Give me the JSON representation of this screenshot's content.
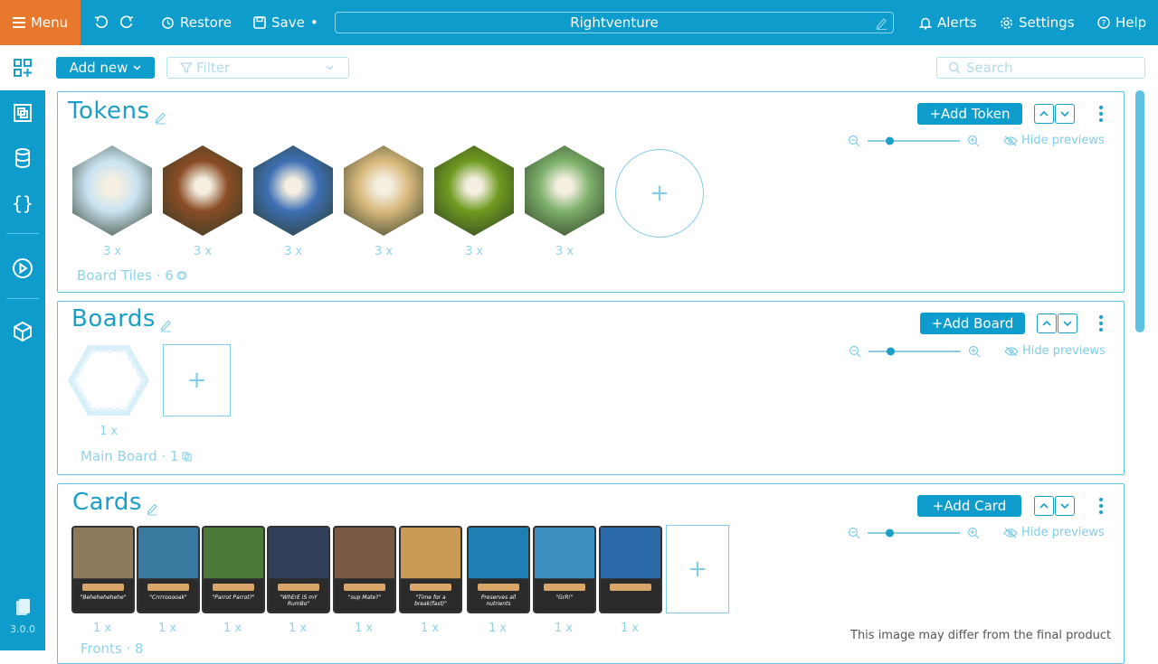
{
  "topbar": {
    "menu_label": "Menu",
    "restore_label": "Restore",
    "save_label": "Save",
    "save_dot": "•",
    "project_title": "Rightventure",
    "alerts_label": "Alerts",
    "settings_label": "Settings",
    "help_label": "Help"
  },
  "toolbar": {
    "add_new_label": "Add new",
    "filter_placeholder": "Filter",
    "search_placeholder": "Search"
  },
  "sidebar": {
    "icons": [
      "add-component-icon",
      "layers-icon",
      "database-icon",
      "braces-icon",
      "play-icon",
      "box-icon",
      "file-icon"
    ],
    "version": "3.0.0"
  },
  "sections": {
    "tokens": {
      "title": "Tokens",
      "add_label": "+Add Token",
      "hide_previews": "Hide previews",
      "items": [
        {
          "count": "3 x",
          "color": "#c9e3f2"
        },
        {
          "count": "3 x",
          "color": "#8a4c25"
        },
        {
          "count": "3 x",
          "color": "#3d6fb3"
        },
        {
          "count": "3 x",
          "color": "#d9b97c"
        },
        {
          "count": "3 x",
          "color": "#6e9a1f"
        },
        {
          "count": "3 x",
          "color": "#7db06a"
        }
      ],
      "group_label": "Board Tiles · 6",
      "zoom_level": 0.25
    },
    "boards": {
      "title": "Boards",
      "add_label": "+Add Board",
      "hide_previews": "Hide previews",
      "items": [
        {
          "count": "1 x"
        }
      ],
      "group_label": "Main Board · 1",
      "zoom_level": 0.25
    },
    "cards": {
      "title": "Cards",
      "add_label": "+Add Card",
      "hide_previews": "Hide previews",
      "items": [
        {
          "count": "1 x",
          "quote": "\"Behehehehehe\"",
          "color": "#8c7a5a"
        },
        {
          "count": "1 x",
          "quote": "\"Crrrrooooak\"",
          "color": "#3a7aa0"
        },
        {
          "count": "1 x",
          "quote": "\"Parrot Parrot?\"",
          "color": "#4b7a3a"
        },
        {
          "count": "1 x",
          "quote": "\"WhErE iS mY RumBo\"",
          "color": "#2f4058"
        },
        {
          "count": "1 x",
          "quote": "\"sup Mate?\"",
          "color": "#7a5a45"
        },
        {
          "count": "1 x",
          "quote": "\"Time for a break(fast)\"",
          "color": "#c99a55"
        },
        {
          "count": "1 x",
          "quote": "Preserves all nutrients",
          "color": "#1f7fb3"
        },
        {
          "count": "1 x",
          "quote": "\"GrR!\"",
          "color": "#3c8fc0"
        },
        {
          "count": "1 x",
          "quote": "",
          "color": "#2a6aa8"
        }
      ],
      "group_label": "Fronts · 8",
      "zoom_level": 0.25
    }
  },
  "disclaimer": "This image may differ from the final product",
  "colors": {
    "accent": "#0d9ccc",
    "menu": "#e8782b",
    "light": "#7fcde6"
  }
}
